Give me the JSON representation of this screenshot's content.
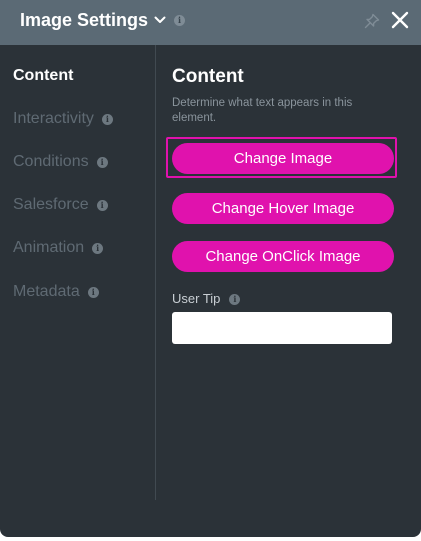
{
  "header": {
    "title": "Image Settings",
    "title_icon": "chevron-down-icon",
    "info_icon": "info-icon",
    "pin_icon": "pin-icon",
    "close_icon": "close-icon"
  },
  "sidebar": {
    "items": [
      {
        "label": "Content",
        "active": true,
        "info": false
      },
      {
        "label": "Interactivity",
        "active": false,
        "info": true
      },
      {
        "label": "Conditions",
        "active": false,
        "info": true
      },
      {
        "label": "Salesforce",
        "active": false,
        "info": true
      },
      {
        "label": "Animation",
        "active": false,
        "info": true
      },
      {
        "label": "Metadata",
        "active": false,
        "info": true
      }
    ]
  },
  "content": {
    "title": "Content",
    "description": "Determine what text appears in this element.",
    "buttons": {
      "change_image": "Change Image",
      "change_hover_image": "Change Hover Image",
      "change_onclick_image": "Change OnClick Image"
    },
    "user_tip": {
      "label": "User Tip",
      "value": "",
      "placeholder": ""
    }
  },
  "info_glyph": "i",
  "colors": {
    "panel_bg": "#2b3238",
    "header_bg": "#5b6a75",
    "accent": "#e012ad",
    "muted_text": "#5f6a73"
  }
}
